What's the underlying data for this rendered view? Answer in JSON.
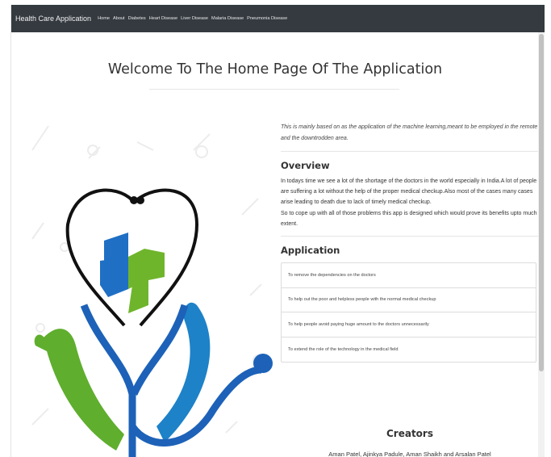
{
  "navbar": {
    "brand": "Health Care Application",
    "links": [
      "Home",
      "About",
      "Diabetes",
      "Heart Disease",
      "Liver Disease",
      "Malaria Disease",
      "Pneumonia Disease"
    ]
  },
  "main": {
    "title": "Welcome To The Home Page Of The Application",
    "intro": "This is mainly based on as the application of the machine learning,meant to be employed in the remote and the downtrodden area.",
    "overview": {
      "heading": "Overview",
      "paragraph1": "In todays time we see a lot of the shortage of the doctors in the world especially in India.A lot of people are suffering a lot without the help of the proper medical checkup.Also most of the cases many cases arise leading to death due to lack of timely medical checkup.",
      "paragraph2": "So to cope up with all of those problems this app is designed which would prove its benefits upto much extent."
    },
    "application": {
      "heading": "Application",
      "items": [
        "To remove the dependencies on the doctors",
        "To help out the poor and helpless people with the normal medical checkup",
        "To help people avoid paying huge amount to the doctors unnecessarily",
        "To extend the role of the technology in the medical field"
      ]
    },
    "creators": {
      "heading": "Creators",
      "names": "Aman Patel, Ajinkya Padule, Aman Shaikh and Arsalan Patel"
    }
  },
  "colors": {
    "navbar_bg": "#343a40",
    "logo_blue": "#1f6fc5",
    "logo_green": "#6fb52c",
    "logo_dark": "#1a1a1a"
  },
  "icons": [
    "stethoscope-heart-logo",
    "medical-cross-icon",
    "hand-icon"
  ]
}
